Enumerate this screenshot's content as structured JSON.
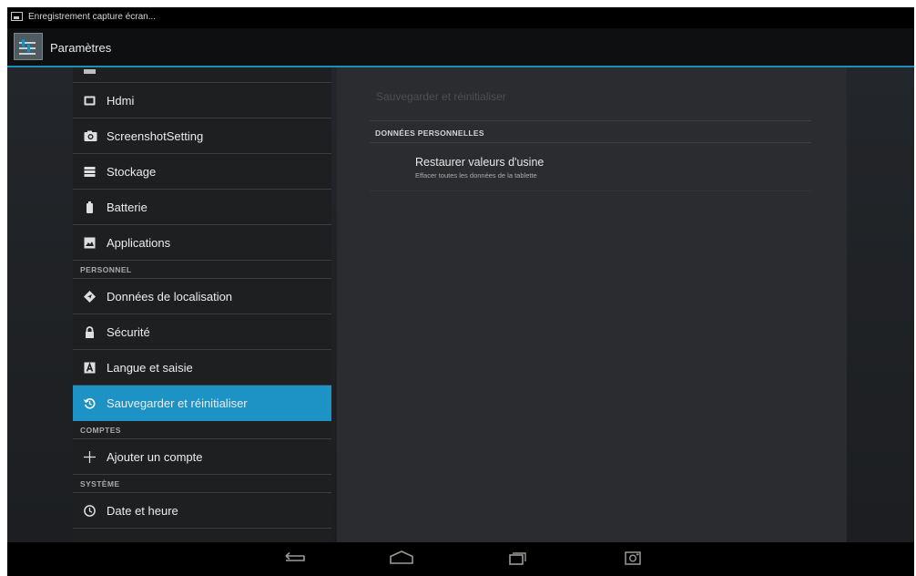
{
  "status_bar": {
    "notification_text": "Enregistrement capture écran...",
    "icon": "screenshot-notification-icon"
  },
  "action_bar": {
    "title": "Paramètres",
    "icon": "settings-app-icon"
  },
  "sidebar": {
    "items": [
      {
        "type": "item",
        "label": "Hdmi",
        "icon": "hdmi-icon"
      },
      {
        "type": "item",
        "label": "ScreenshotSetting",
        "icon": "camera-icon"
      },
      {
        "type": "item",
        "label": "Stockage",
        "icon": "storage-icon"
      },
      {
        "type": "item",
        "label": "Batterie",
        "icon": "battery-icon"
      },
      {
        "type": "item",
        "label": "Applications",
        "icon": "applications-icon"
      },
      {
        "type": "header",
        "label": "PERSONNEL"
      },
      {
        "type": "item",
        "label": "Données de localisation",
        "icon": "location-icon"
      },
      {
        "type": "item",
        "label": "Sécurité",
        "icon": "lock-icon"
      },
      {
        "type": "item",
        "label": "Langue et saisie",
        "icon": "language-icon"
      },
      {
        "type": "item",
        "label": "Sauvegarder et réinitialiser",
        "icon": "backup-restore-icon",
        "selected": true
      },
      {
        "type": "header",
        "label": "COMPTES"
      },
      {
        "type": "item",
        "label": "Ajouter un compte",
        "icon": "plus-icon"
      },
      {
        "type": "header",
        "label": "SYSTÈME"
      },
      {
        "type": "item",
        "label": "Date et heure",
        "icon": "clock-icon"
      }
    ]
  },
  "detail": {
    "title": "Sauvegarder et réinitialiser",
    "section_header": "DONNÉES PERSONNELLES",
    "item_title": "Restaurer valeurs d'usine",
    "item_subtitle": "Effacer toutes les données de la tablette"
  },
  "nav_bar": {
    "buttons": [
      "back-icon",
      "home-icon",
      "recent-apps-icon",
      "screenshot-icon"
    ]
  },
  "colors": {
    "accent": "#1c93c4",
    "background": "#1b1d1f"
  }
}
